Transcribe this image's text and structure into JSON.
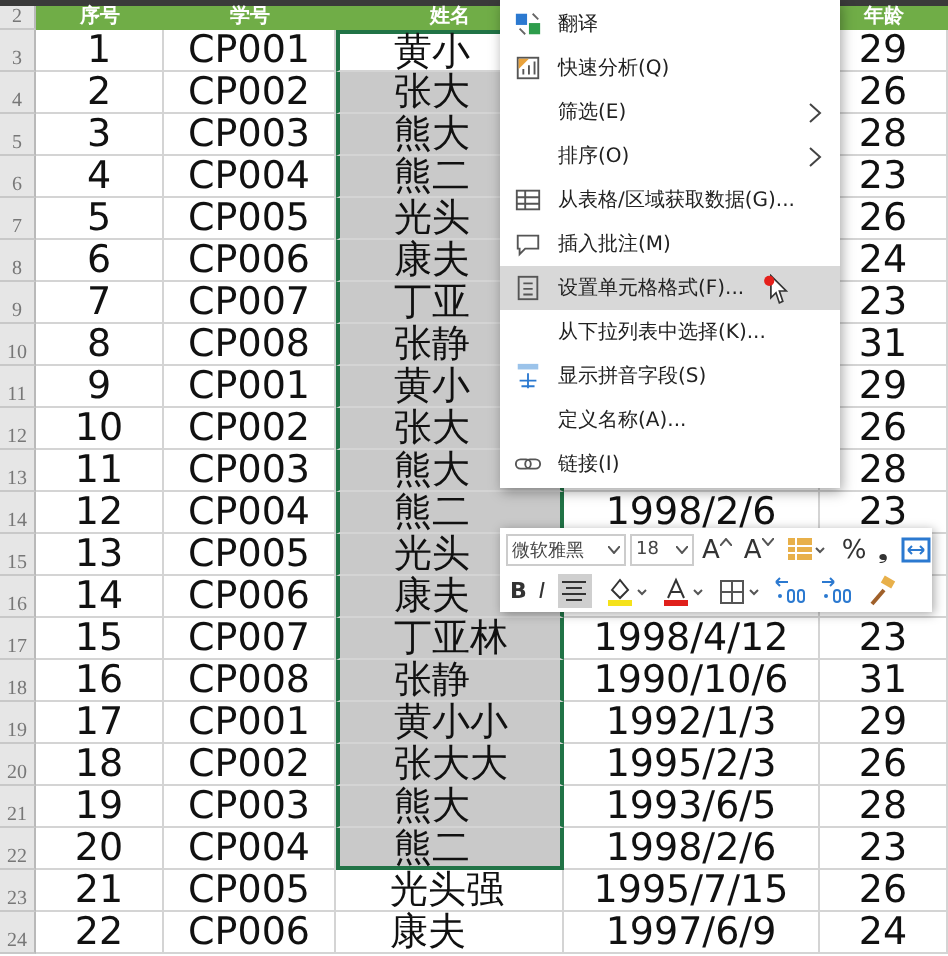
{
  "header": {
    "row_number": "2",
    "seq": "序号",
    "code": "学号",
    "name": "姓名",
    "age": "年龄"
  },
  "rows": [
    {
      "row_number": "3",
      "seq": "1",
      "code": "CP001",
      "name": "黄小",
      "age": "29",
      "selected": true
    },
    {
      "row_number": "4",
      "seq": "2",
      "code": "CP002",
      "name": "张大",
      "age": "26",
      "selected": true
    },
    {
      "row_number": "5",
      "seq": "3",
      "code": "CP003",
      "name": "熊大",
      "age": "28",
      "selected": true
    },
    {
      "row_number": "6",
      "seq": "4",
      "code": "CP004",
      "name": "熊二",
      "age": "23",
      "selected": true
    },
    {
      "row_number": "7",
      "seq": "5",
      "code": "CP005",
      "name": "光头",
      "age": "26",
      "selected": true
    },
    {
      "row_number": "8",
      "seq": "6",
      "code": "CP006",
      "name": "康夫",
      "age": "24",
      "selected": true
    },
    {
      "row_number": "9",
      "seq": "7",
      "code": "CP007",
      "name": "丁亚",
      "age": "23",
      "selected": true
    },
    {
      "row_number": "10",
      "seq": "8",
      "code": "CP008",
      "name": "张静",
      "age": "31",
      "selected": true
    },
    {
      "row_number": "11",
      "seq": "9",
      "code": "CP001",
      "name": "黄小",
      "age": "29",
      "selected": true
    },
    {
      "row_number": "12",
      "seq": "10",
      "code": "CP002",
      "name": "张大",
      "age": "26",
      "selected": true
    },
    {
      "row_number": "13",
      "seq": "11",
      "code": "CP003",
      "name": "熊大",
      "age": "28",
      "selected": true
    },
    {
      "row_number": "14",
      "seq": "12",
      "code": "CP004",
      "name": "熊二",
      "date": "1998/2/6",
      "age": "23",
      "selected": true
    },
    {
      "row_number": "15",
      "seq": "13",
      "code": "CP005",
      "name": "光头",
      "selected": true
    },
    {
      "row_number": "16",
      "seq": "14",
      "code": "CP006",
      "name": "康夫",
      "selected": true
    },
    {
      "row_number": "17",
      "seq": "15",
      "code": "CP007",
      "name": "丁亚林",
      "date": "1998/4/12",
      "age": "23",
      "selected": true
    },
    {
      "row_number": "18",
      "seq": "16",
      "code": "CP008",
      "name": "张静",
      "date": "1990/10/6",
      "age": "31",
      "selected": true
    },
    {
      "row_number": "19",
      "seq": "17",
      "code": "CP001",
      "name": "黄小小",
      "date": "1992/1/3",
      "age": "29",
      "selected": true
    },
    {
      "row_number": "20",
      "seq": "18",
      "code": "CP002",
      "name": "张大大",
      "date": "1995/2/3",
      "age": "26",
      "selected": true
    },
    {
      "row_number": "21",
      "seq": "19",
      "code": "CP003",
      "name": "熊大",
      "date": "1993/6/5",
      "age": "28",
      "selected": true
    },
    {
      "row_number": "22",
      "seq": "20",
      "code": "CP004",
      "name": "熊二",
      "date": "1998/2/6",
      "age": "23",
      "selected": true
    },
    {
      "row_number": "23",
      "seq": "21",
      "code": "CP005",
      "name": "光头强",
      "date": "1995/7/15",
      "age": "26",
      "selected": false
    },
    {
      "row_number": "24",
      "seq": "22",
      "code": "CP006",
      "name": "康夫",
      "date": "1997/6/9",
      "age": "24",
      "selected": false
    }
  ],
  "context_menu": [
    {
      "label": "翻译",
      "kind": "translate",
      "submenu": false,
      "selected": false
    },
    {
      "label": "快速分析(Q)",
      "kind": "analysis",
      "submenu": false,
      "selected": false
    },
    {
      "label": "筛选(E)",
      "kind": "plain",
      "submenu": true,
      "selected": false
    },
    {
      "label": "排序(O)",
      "kind": "plain",
      "submenu": true,
      "selected": false
    },
    {
      "label": "从表格/区域获取数据(G)...",
      "kind": "table",
      "submenu": false,
      "selected": false
    },
    {
      "label": "插入批注(M)",
      "kind": "comment",
      "submenu": false,
      "selected": false
    },
    {
      "label": "设置单元格格式(F)...",
      "kind": "format",
      "submenu": false,
      "selected": true
    },
    {
      "label": "从下拉列表中选择(K)...",
      "kind": "plain",
      "submenu": false,
      "selected": false
    },
    {
      "label": "显示拼音字段(S)",
      "kind": "pinyin",
      "submenu": false,
      "selected": false
    },
    {
      "label": "定义名称(A)...",
      "kind": "plain",
      "submenu": false,
      "selected": false
    },
    {
      "label": "链接(I)",
      "kind": "link",
      "submenu": false,
      "selected": false
    }
  ],
  "mini_toolbar": {
    "font": "微软雅黑",
    "size": "18",
    "row_1": [
      {
        "kind": "grow",
        "label": "A"
      },
      {
        "kind": "shrink",
        "label": "A"
      },
      {
        "kind": "table-style",
        "selected": false
      },
      {
        "kind": "text",
        "label": "%"
      },
      {
        "kind": "text",
        "label": "❟"
      },
      {
        "kind": "merge",
        "selected": false
      }
    ],
    "row_2": [
      {
        "kind": "bold",
        "label": "B"
      },
      {
        "kind": "italic",
        "label": "I"
      },
      {
        "kind": "align",
        "selected": true
      },
      {
        "kind": "fill",
        "selected": false
      },
      {
        "kind": "font-color",
        "selected": false
      },
      {
        "kind": "borders",
        "selected": false
      },
      {
        "kind": "decimal-up",
        "selected": false
      },
      {
        "kind": "decimal-down",
        "selected": false
      },
      {
        "kind": "painter",
        "selected": false
      }
    ]
  }
}
